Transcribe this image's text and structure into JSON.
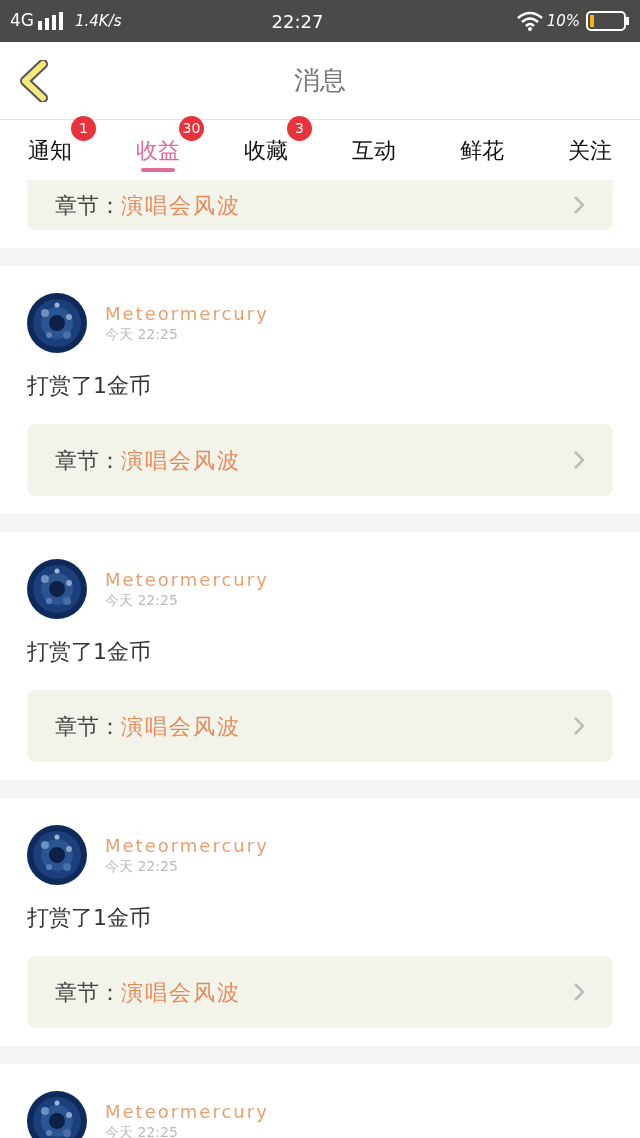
{
  "status_bar": {
    "network": "4G",
    "speed": "1.4K/s",
    "time": "22:27",
    "battery": "10%"
  },
  "header": {
    "title": "消息"
  },
  "tabs": [
    {
      "label": "通知",
      "selected": false,
      "badge": "1"
    },
    {
      "label": "收益",
      "selected": true,
      "badge": "30"
    },
    {
      "label": "收藏",
      "selected": false,
      "badge": "3"
    },
    {
      "label": "互动",
      "selected": false
    },
    {
      "label": "鲜花",
      "selected": false
    },
    {
      "label": "关注",
      "selected": false
    }
  ],
  "items": [
    {
      "kind": "chapter_only",
      "chapter_label": "章节：",
      "chapter": "演唱会风波"
    },
    {
      "kind": "full",
      "user": "Meteormercury",
      "time": "今天  22:25",
      "message": "打赏了1金币",
      "chapter_label": "章节：",
      "chapter": "演唱会风波"
    },
    {
      "kind": "full",
      "user": "Meteormercury",
      "time": "今天  22:25",
      "message": "打赏了1金币",
      "chapter_label": "章节：",
      "chapter": "演唱会风波"
    },
    {
      "kind": "full",
      "user": "Meteormercury",
      "time": "今天  22:25",
      "message": "打赏了1金币",
      "chapter_label": "章节：",
      "chapter": "演唱会风波"
    },
    {
      "kind": "header_only",
      "user": "Meteormercury",
      "time": "今天  22:25"
    }
  ]
}
